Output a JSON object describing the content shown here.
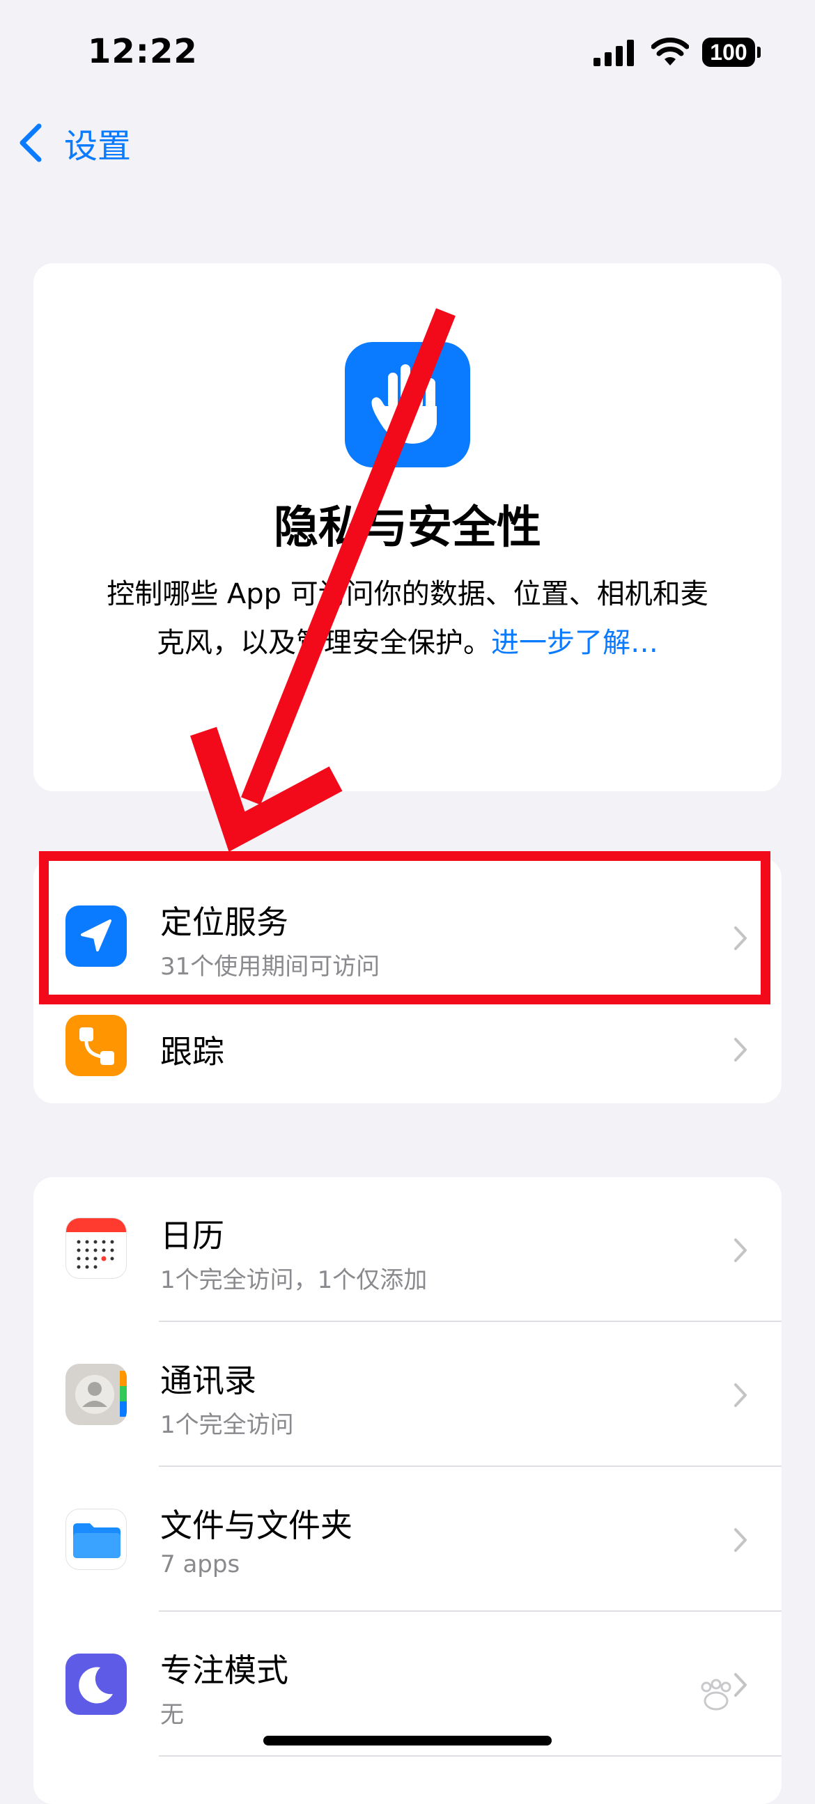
{
  "status_bar": {
    "time": "12:22",
    "battery": "100"
  },
  "nav": {
    "back_label": "设置"
  },
  "header": {
    "title": "隐私与安全性",
    "description": "控制哪些 App 可访问你的数据、位置、相机和麦克风，以及管理安全保护。",
    "learn_more": "进一步了解…"
  },
  "group1": [
    {
      "title": "定位服务",
      "subtitle": "31个使用期间可访问",
      "icon": "location-arrow-icon",
      "icon_color": "#0a7aff"
    },
    {
      "title": "跟踪",
      "subtitle": "",
      "icon": "tracking-icon",
      "icon_color": "#ff9500"
    }
  ],
  "group2": [
    {
      "title": "日历",
      "subtitle": "1个完全访问，1个仅添加",
      "icon": "calendar-icon"
    },
    {
      "title": "通讯录",
      "subtitle": "1个完全访问",
      "icon": "contacts-icon"
    },
    {
      "title": "文件与文件夹",
      "subtitle": "7 apps",
      "icon": "files-folder-icon"
    },
    {
      "title": "专注模式",
      "subtitle": "无",
      "icon": "focus-moon-icon",
      "icon_color": "#5e5ce6"
    }
  ],
  "annotation": {
    "color": "#f20a1a"
  }
}
